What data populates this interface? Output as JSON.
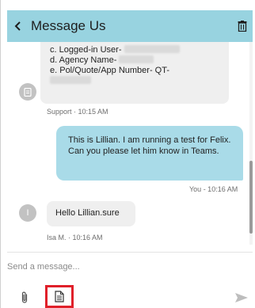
{
  "header": {
    "title": "Message Us"
  },
  "messages": {
    "support_message": {
      "lines": [
        "c. Logged-in User-",
        "d. Agency Name-",
        "e. Pol/Quote/App Number- QT-"
      ],
      "meta": "Support · 10:15 AM"
    },
    "you_message": {
      "text": "This is Lillian. I am running a test for Felix. Can you please let him know in Teams.",
      "meta": "You - 10:16 AM"
    },
    "reply_message": {
      "avatar_initial": "I",
      "text": "Hello  Lillian.sure",
      "meta": "Isa M. · 10:16 AM"
    }
  },
  "composer": {
    "placeholder": "Send a message..."
  },
  "icons": {
    "back": "chevron-left-icon",
    "trash": "trash-icon",
    "support_avatar": "document-icon",
    "attach": "paperclip-icon",
    "attach_document": "document-icon",
    "send": "send-icon"
  },
  "colors": {
    "header": "#98d3e0",
    "outgoing_bubble": "#a9dbe8",
    "incoming_bubble": "#efefef",
    "highlight_border": "#e0202a"
  }
}
